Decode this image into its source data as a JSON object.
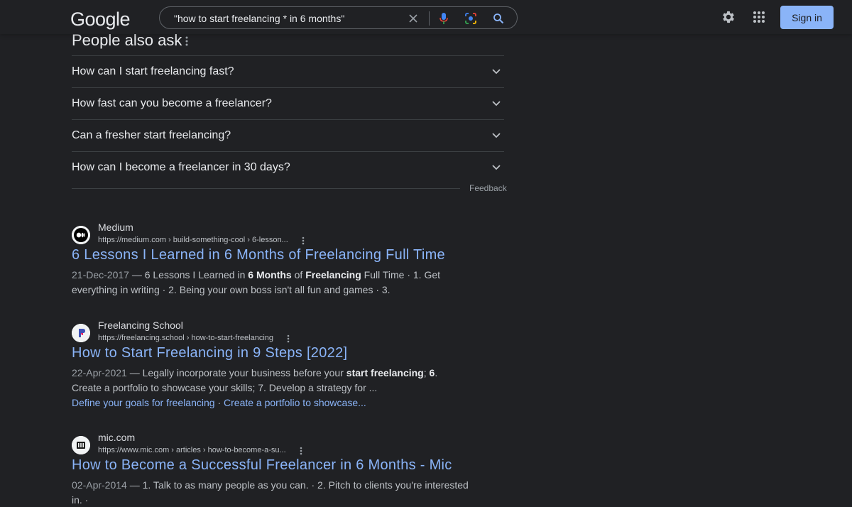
{
  "header": {
    "logo": "Google",
    "search": {
      "value": "\"how to start freelancing * in 6 months\""
    },
    "sign_in": "Sign in"
  },
  "paa": {
    "title": "People also ask",
    "questions": [
      "How can I start freelancing fast?",
      "How fast can you become a freelancer?",
      "Can a fresher start freelancing?",
      "How can I become a freelancer in 30 days?"
    ],
    "feedback": "Feedback"
  },
  "results": [
    {
      "site": "Medium",
      "url": "https://medium.com › build-something-cool › 6-lesson...",
      "title": "6 Lessons I Learned in 6 Months of Freelancing Full Time",
      "date": "21-Dec-2017",
      "snippet_1": " — 6 Lessons I Learned in ",
      "bold_1": "6",
      "snippet_2": " ",
      "bold_2": "Months",
      "snippet_3": " of ",
      "bold_3": "Freelancing",
      "snippet_4": " Full Time · 1. Get everything in writing · 2. Being your own boss isn't all fun and games · 3."
    },
    {
      "site": "Freelancing School",
      "url": "https://freelancing.school › how-to-start-freelancing",
      "title": "How to Start Freelancing in 9 Steps [2022]",
      "date": "22-Apr-2021",
      "snippet_1": " — Legally incorporate your business before your ",
      "bold_1": "start",
      "snippet_2": " ",
      "bold_2": "freelancing",
      "snippet_3": "; ",
      "bold_3": "6",
      "snippet_4": ". Create a portfolio to showcase your skills; 7. Develop a strategy for ...",
      "link_1": "Define your goals for freelancing",
      "link_sep": " · ",
      "link_2": "Create a portfolio to showcase..."
    },
    {
      "site": "mic.com",
      "url": "https://www.mic.com › articles › how-to-become-a-su...",
      "title": "How to Become a Successful Freelancer in 6 Months - Mic",
      "date": "02-Apr-2014",
      "snippet_1": " — 1. Talk to as many people as you can. · 2. Pitch to clients you're interested in. ·"
    }
  ],
  "colors": {
    "background": "#202124",
    "link": "#8ab4f8",
    "text": "#bdc1c6",
    "heading": "#e8eaed"
  }
}
